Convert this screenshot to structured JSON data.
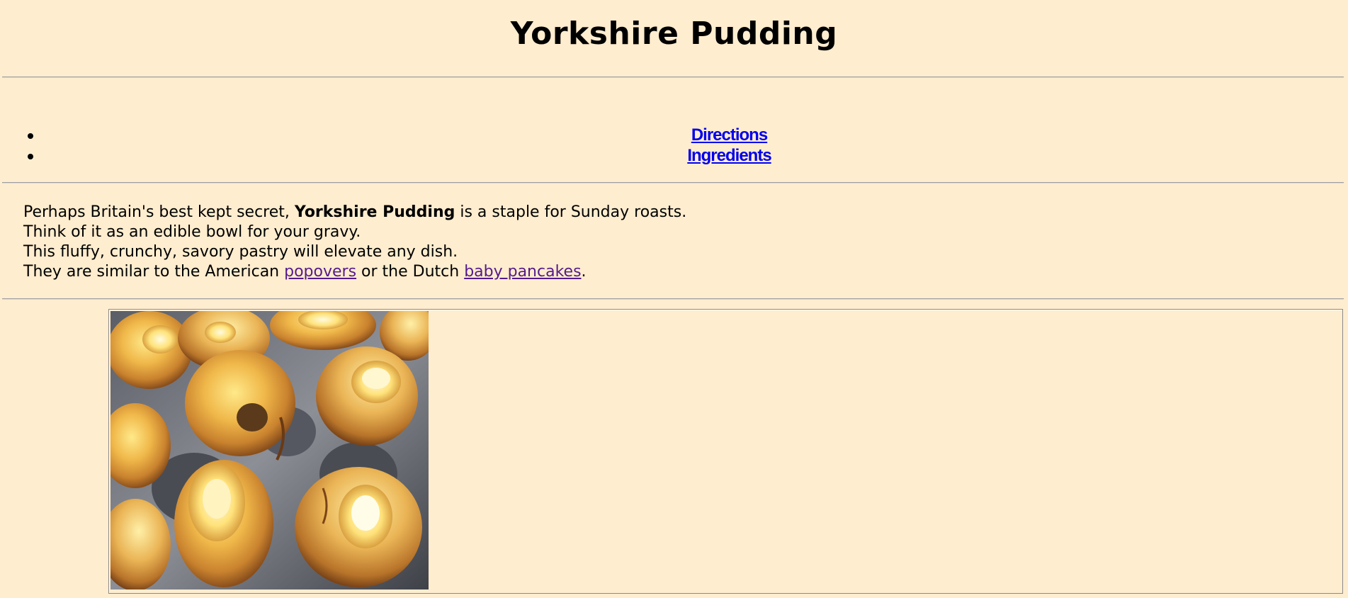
{
  "page": {
    "title": "Yorkshire Pudding"
  },
  "nav": {
    "items": [
      {
        "label": "Directions"
      },
      {
        "label": "Ingredients"
      }
    ]
  },
  "intro": {
    "line1_prefix": "Perhaps Britain's best kept secret, ",
    "line1_bold": "Yorkshire Pudding",
    "line1_suffix": " is a staple for Sunday roasts.",
    "line2": "Think of it as an edible bowl for your gravy.",
    "line3": "This fluffy, crunchy, savory pastry will elevate any dish.",
    "line4_prefix": "They are similar to the American ",
    "link_popovers": "popovers",
    "line4_middle": " or the Dutch ",
    "link_baby_pancakes": "baby pancakes",
    "line4_suffix": "."
  },
  "colors": {
    "background": "#ffedcf",
    "link": "#0000ee",
    "visited_link": "#551a8b"
  }
}
